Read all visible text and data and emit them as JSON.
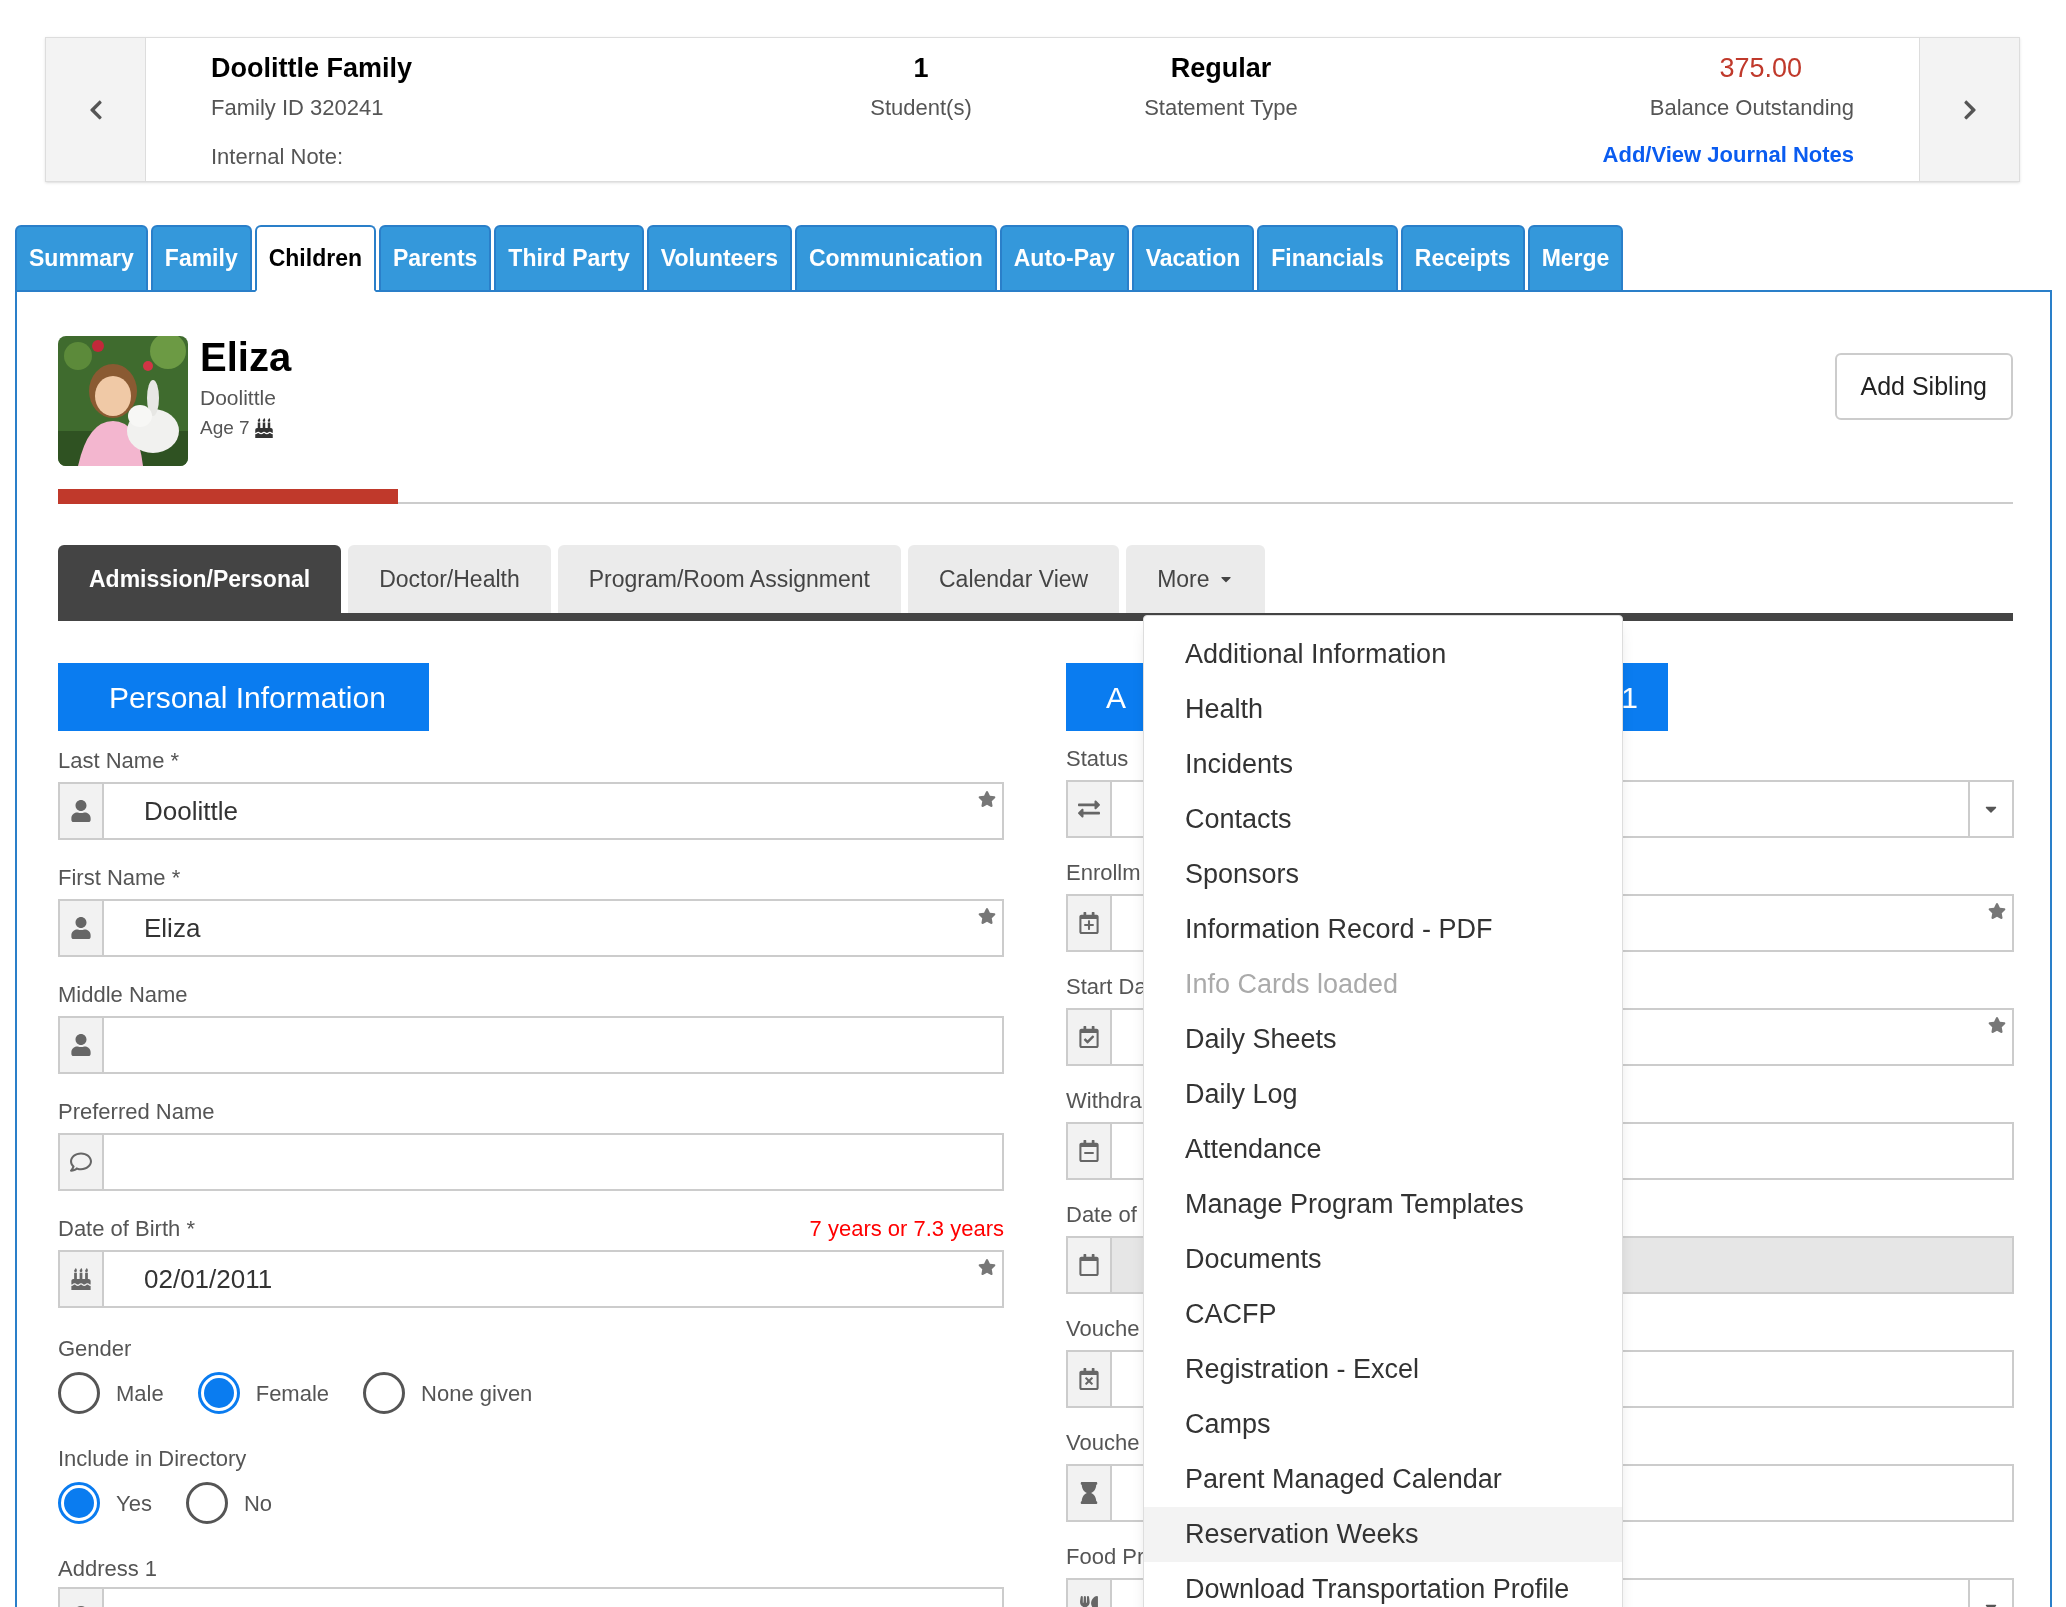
{
  "family": {
    "name": "Doolittle Family",
    "id": "Family ID 320241",
    "internal_note": "Internal Note:",
    "students": {
      "value": "1",
      "label": "Student(s)"
    },
    "statement": {
      "value": "Regular",
      "label": "Statement Type"
    },
    "balance": {
      "value": "375.00",
      "label": "Balance Outstanding"
    },
    "journal_link": "Add/View Journal Notes"
  },
  "tabs": [
    {
      "label": "Summary",
      "selected": false
    },
    {
      "label": "Family",
      "selected": false
    },
    {
      "label": "Children",
      "selected": true
    },
    {
      "label": "Parents",
      "selected": false
    },
    {
      "label": "Third Party",
      "selected": false
    },
    {
      "label": "Volunteers",
      "selected": false
    },
    {
      "label": "Communication",
      "selected": false
    },
    {
      "label": "Auto-Pay",
      "selected": false
    },
    {
      "label": "Vacation",
      "selected": false
    },
    {
      "label": "Financials",
      "selected": false
    },
    {
      "label": "Receipts",
      "selected": false
    },
    {
      "label": "Merge",
      "selected": false
    }
  ],
  "child": {
    "first_name": "Eliza",
    "last_name": "Doolittle",
    "age": "Age 7",
    "progress": {
      "level": 0.174
    }
  },
  "add_sibling": "Add Sibling",
  "subtabs": [
    {
      "label": "Admission/Personal",
      "selected": true,
      "kind": "tab"
    },
    {
      "label": "Doctor/Health",
      "selected": false,
      "kind": "tab"
    },
    {
      "label": "Program/Room Assignment",
      "selected": false,
      "kind": "tab"
    },
    {
      "label": "Calendar View",
      "selected": false,
      "kind": "tab"
    },
    {
      "label": "More",
      "selected": false,
      "kind": "dropdown"
    }
  ],
  "personal": {
    "title": "Personal Information",
    "fields": [
      {
        "label": "Last Name *",
        "value": "Doolittle",
        "starred": true
      },
      {
        "label": "First Name *",
        "value": "Eliza",
        "starred": true
      },
      {
        "label": "Middle Name",
        "starred": false
      },
      {
        "label": "Preferred Name",
        "starred": false
      },
      {
        "label": "Date of Birth *",
        "value": "02/01/2011",
        "starred": true,
        "note": "7 years or 7.3 years"
      }
    ],
    "gender": {
      "label": "Gender",
      "options": [
        {
          "label": "Male",
          "selected": false
        },
        {
          "label": "Female",
          "selected": true
        },
        {
          "label": "None given",
          "selected": false
        }
      ]
    },
    "directory": {
      "label": "Include in Directory",
      "options": [
        {
          "label": "Yes",
          "selected": true
        },
        {
          "label": "No",
          "selected": false
        }
      ]
    },
    "address": {
      "label": "Address 1"
    }
  },
  "admission": {
    "title_start": "A",
    "title_end": "1",
    "fields": [
      {
        "label": "Status",
        "kind": "select",
        "starred": false,
        "disabled": false
      },
      {
        "label": "Enrollm",
        "kind": "input",
        "starred": true,
        "disabled": false
      },
      {
        "label": "Start Da",
        "kind": "input",
        "starred": true,
        "disabled": false
      },
      {
        "label": "Withdra",
        "kind": "input",
        "starred": false,
        "disabled": false
      },
      {
        "label": "Date of",
        "kind": "input",
        "starred": false,
        "disabled": true
      },
      {
        "label": "Vouche",
        "kind": "input",
        "starred": false,
        "disabled": false
      },
      {
        "label": "Vouche",
        "kind": "input",
        "starred": false,
        "disabled": false
      },
      {
        "label": "Food Pr",
        "kind": "select",
        "starred": false,
        "disabled": false
      }
    ]
  },
  "more_menu": [
    {
      "label": "Additional Information",
      "disabled": false,
      "highlighted": false
    },
    {
      "label": "Health",
      "disabled": false,
      "highlighted": false
    },
    {
      "label": "Incidents",
      "disabled": false,
      "highlighted": false
    },
    {
      "label": "Contacts",
      "disabled": false,
      "highlighted": false
    },
    {
      "label": "Sponsors",
      "disabled": false,
      "highlighted": false
    },
    {
      "label": "Information Record - PDF",
      "disabled": false,
      "highlighted": false
    },
    {
      "label": "Info Cards loaded",
      "disabled": true,
      "highlighted": false
    },
    {
      "label": "Daily Sheets",
      "disabled": false,
      "highlighted": false
    },
    {
      "label": "Daily Log",
      "disabled": false,
      "highlighted": false
    },
    {
      "label": "Attendance",
      "disabled": false,
      "highlighted": false
    },
    {
      "label": "Manage Program Templates",
      "disabled": false,
      "highlighted": false
    },
    {
      "label": "Documents",
      "disabled": false,
      "highlighted": false
    },
    {
      "label": "CACFP",
      "disabled": false,
      "highlighted": false
    },
    {
      "label": "Registration - Excel",
      "disabled": false,
      "highlighted": false
    },
    {
      "label": "Camps",
      "disabled": false,
      "highlighted": false
    },
    {
      "label": "Parent Managed Calendar",
      "disabled": false,
      "highlighted": false
    },
    {
      "label": "Reservation Weeks",
      "disabled": false,
      "highlighted": true
    },
    {
      "label": "Download Transportation Profile",
      "disabled": false,
      "highlighted": false
    }
  ]
}
